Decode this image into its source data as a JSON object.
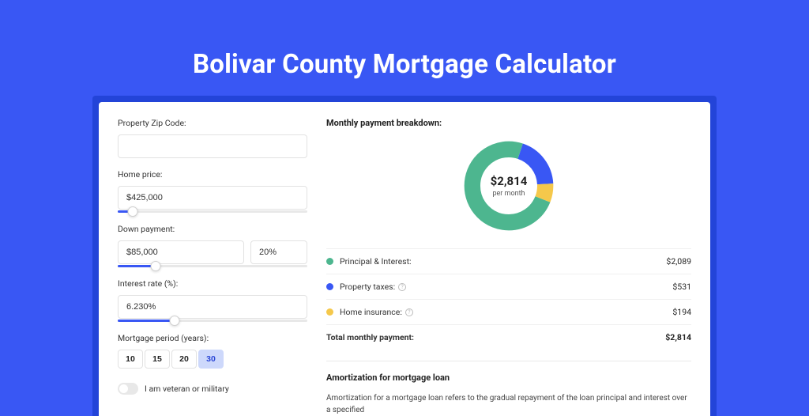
{
  "title": "Bolivar County Mortgage Calculator",
  "form": {
    "zip": {
      "label": "Property Zip Code:",
      "value": ""
    },
    "home": {
      "label": "Home price:",
      "value": "$425,000",
      "slider_pct": 8
    },
    "down": {
      "label": "Down payment:",
      "value": "$85,000",
      "pct": "20%",
      "slider_pct": 20
    },
    "rate": {
      "label": "Interest rate (%):",
      "value": "6.230%",
      "slider_pct": 30
    },
    "period": {
      "label": "Mortgage period (years):",
      "options": [
        "10",
        "15",
        "20",
        "30"
      ],
      "selected": "30"
    },
    "veteran": {
      "label": "I am veteran or military",
      "on": false
    }
  },
  "breakdown": {
    "title": "Monthly payment breakdown:",
    "total": "$2,814",
    "per": "per month",
    "items": [
      {
        "label": "Principal & Interest:",
        "value": "$2,089",
        "color": "#4db68f",
        "pct": 74,
        "info": false
      },
      {
        "label": "Property taxes:",
        "value": "$531",
        "color": "#3957f4",
        "pct": 19,
        "info": true
      },
      {
        "label": "Home insurance:",
        "value": "$194",
        "color": "#f5c84b",
        "pct": 7,
        "info": true
      }
    ],
    "total_label": "Total monthly payment:",
    "total_value": "$2,814"
  },
  "amort": {
    "title": "Amortization for mortgage loan",
    "text": "Amortization for a mortgage loan refers to the gradual repayment of the loan principal and interest over a specified"
  },
  "chart_data": {
    "type": "pie",
    "title": "Monthly payment breakdown",
    "series": [
      {
        "name": "Principal & Interest",
        "value": 2089,
        "color": "#4db68f"
      },
      {
        "name": "Property taxes",
        "value": 531,
        "color": "#3957f4"
      },
      {
        "name": "Home insurance",
        "value": 194,
        "color": "#f5c84b"
      }
    ],
    "total": 2814,
    "unit": "$ per month"
  }
}
